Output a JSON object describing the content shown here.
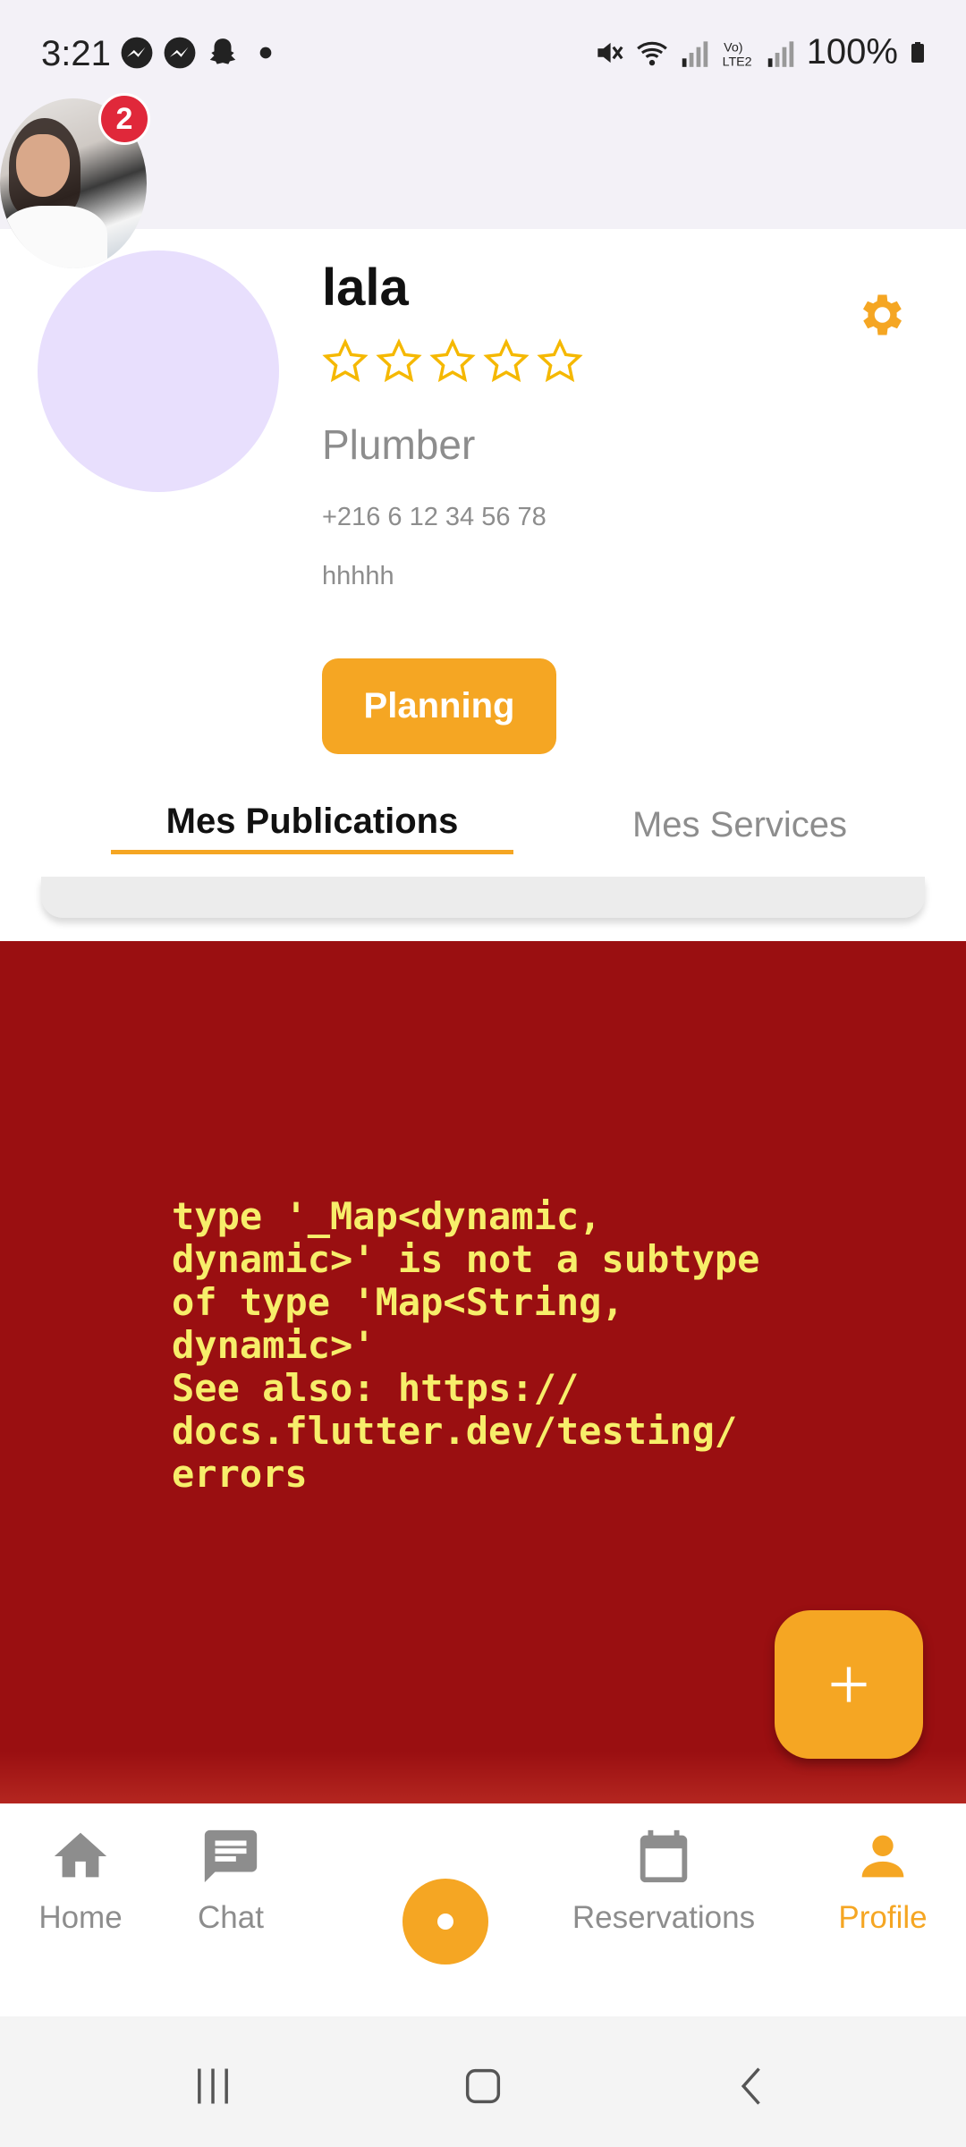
{
  "status_bar": {
    "time": "3:21",
    "battery": "100%",
    "network_label": "LTE2"
  },
  "chat_head": {
    "badge_count": "2"
  },
  "profile": {
    "name": "lala",
    "rating_stars": 5,
    "rating_filled": 0,
    "job": "Plumber",
    "phone": "+216 6 12 34 56 78",
    "description": "hhhhh",
    "planning_label": "Planning"
  },
  "tabs": {
    "publications": "Mes Publications",
    "services": "Mes Services"
  },
  "error": {
    "message": "type '_Map<dynamic,\ndynamic>' is not a subtype\nof type 'Map<String,\ndynamic>'\nSee also: https://\ndocs.flutter.dev/testing/\nerrors"
  },
  "bottom_nav": {
    "home": "Home",
    "chat": "Chat",
    "reservations": "Reservations",
    "profile": "Profile"
  },
  "colors": {
    "accent": "#f5a623",
    "error_bg": "#9a0f11",
    "error_text": "#f7ee6a",
    "avatar_bg": "#e8dffd"
  }
}
